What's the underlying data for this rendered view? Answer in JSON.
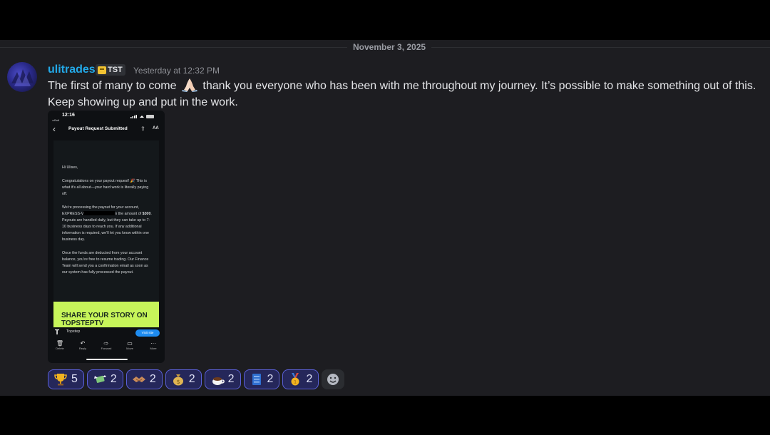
{
  "date_divider": "November 3, 2025",
  "message": {
    "username": "ulitrades",
    "tag": "TST",
    "timestamp": "Yesterday at 12:32 PM",
    "text_part1": "The first of many to come",
    "text_part2": "thank you everyone who has been with me throughout my journey. It’s possible to make something out of this. Keep showing up and put in the work.",
    "text_emoji": "folded-hands"
  },
  "attachment": {
    "status_time": "12:16",
    "status_sub": "◂ Bolt",
    "header_title": "Payout Request Submitted",
    "header_aa": "AA",
    "greeting": "Hi Ulises,",
    "para1": "Congratulations on your payout request! 🎉 This is what it’s all about—your hard work is literally paying off.",
    "para2_a": "We’re processing the payout for your account, EXPRESS-V",
    "para2_b": "n the amount of",
    "para2_amount": "$300",
    "para2_c": ". Payouts are handled daily, but they can take up to 7-10 business days to reach you. If any additional information is required, we’ll let you know within one business day.",
    "para3": "Once the funds are deducted from your account balance, you’re free to resume trading. Our Finance Team will send you a confirmation email as soon as our system has fully processed the payout.",
    "banner_text": "SHARE YOUR STORY ON TOPSTEPTV",
    "sender_name": "Topstep",
    "visit_label": "Visit site",
    "toolbar": [
      "Delete",
      "Reply",
      "Forward",
      "Move",
      "More"
    ],
    "banner_color": "#c7f55a"
  },
  "reactions": [
    {
      "emoji": "trophy",
      "count": "5"
    },
    {
      "emoji": "money-with-wings",
      "count": "2"
    },
    {
      "emoji": "handshake",
      "count": "2"
    },
    {
      "emoji": "money-bag",
      "count": "2"
    },
    {
      "emoji": "hot-beverage",
      "count": "2"
    },
    {
      "emoji": "blue-book",
      "count": "2"
    },
    {
      "emoji": "gold-medal",
      "count": "2"
    }
  ],
  "colors": {
    "username": "#23a9e8",
    "reaction_border": "#5a60d8",
    "reaction_bg": "#25275a"
  }
}
